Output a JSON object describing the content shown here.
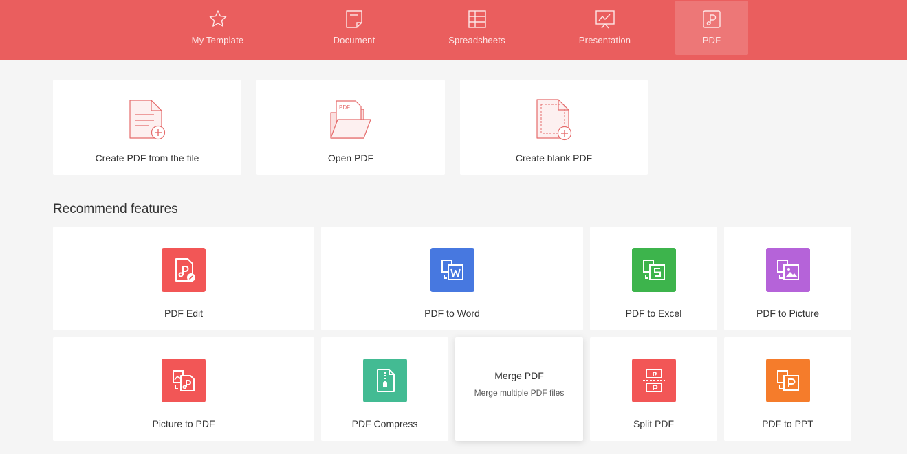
{
  "tabs": [
    {
      "label": "My Template",
      "icon": "star-icon"
    },
    {
      "label": "Document",
      "icon": "document-icon"
    },
    {
      "label": "Spreadsheets",
      "icon": "spreadsheet-icon"
    },
    {
      "label": "Presentation",
      "icon": "presentation-icon"
    },
    {
      "label": "PDF",
      "icon": "pdf-icon",
      "active": true
    }
  ],
  "quick_actions": [
    {
      "label": "Create PDF from the file",
      "icon": "file-plus-icon"
    },
    {
      "label": "Open PDF",
      "icon": "folder-pdf-icon",
      "icon_text": "PDF"
    },
    {
      "label": "Create blank PDF",
      "icon": "blank-file-plus-icon"
    }
  ],
  "recommend": {
    "title": "Recommend features",
    "items": [
      {
        "label": "PDF Edit",
        "icon": "pdf-edit-icon",
        "color": "#f25656"
      },
      {
        "label": "PDF to Word",
        "icon": "pdf-to-word-icon",
        "color": "#4778e0"
      },
      {
        "label": "PDF to Excel",
        "icon": "pdf-to-excel-icon",
        "color": "#3db44c"
      },
      {
        "label": "PDF to Picture",
        "icon": "pdf-to-picture-icon",
        "color": "#b563d9"
      },
      {
        "label": "Picture to PDF",
        "icon": "picture-to-pdf-icon",
        "color": "#f25656"
      },
      {
        "label": "PDF Compress",
        "icon": "pdf-compress-icon",
        "color": "#43bb93"
      },
      {
        "label": "Merge PDF",
        "subtitle": "Merge multiple PDF files",
        "icon": "merge-pdf-icon",
        "hovered": true
      },
      {
        "label": "Split PDF",
        "icon": "split-pdf-icon",
        "color": "#f25656"
      },
      {
        "label": "PDF to PPT",
        "icon": "pdf-to-ppt-icon",
        "color": "#f57c2b"
      }
    ]
  },
  "colors": {
    "header": "#ea5e5e",
    "background": "#f5f5f5",
    "card": "#ffffff",
    "line_icon": "#e56b6b"
  }
}
